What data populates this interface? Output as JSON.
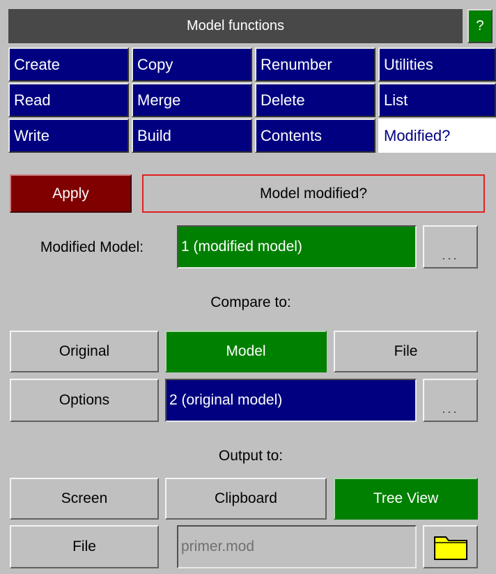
{
  "title": "Model functions",
  "help_label": "?",
  "menu": {
    "row1": [
      "Create",
      "Copy",
      "Renumber",
      "Utilities"
    ],
    "row2": [
      "Read",
      "Merge",
      "Delete",
      "List"
    ],
    "row3": [
      "Write",
      "Build",
      "Contents",
      "Modified?"
    ]
  },
  "apply_label": "Apply",
  "header_label": "Model modified?",
  "modified_model": {
    "label": "Modified Model:",
    "value": "1 (modified model)",
    "browse": "..."
  },
  "compare": {
    "heading": "Compare to:",
    "original": "Original",
    "model": "Model",
    "file": "File",
    "options": "Options",
    "value": "2 (original model)",
    "browse": "..."
  },
  "output": {
    "heading": "Output to:",
    "screen": "Screen",
    "clipboard": "Clipboard",
    "tree_view": "Tree View",
    "file": "File",
    "filename": "primer.mod"
  },
  "colors": {
    "panel": "#c0c0c0",
    "menu_blue": "#000080",
    "active_green": "#008000",
    "apply_red": "#800000",
    "folder_yellow": "#ffff00"
  },
  "icons": {
    "folder": "folder-icon"
  }
}
